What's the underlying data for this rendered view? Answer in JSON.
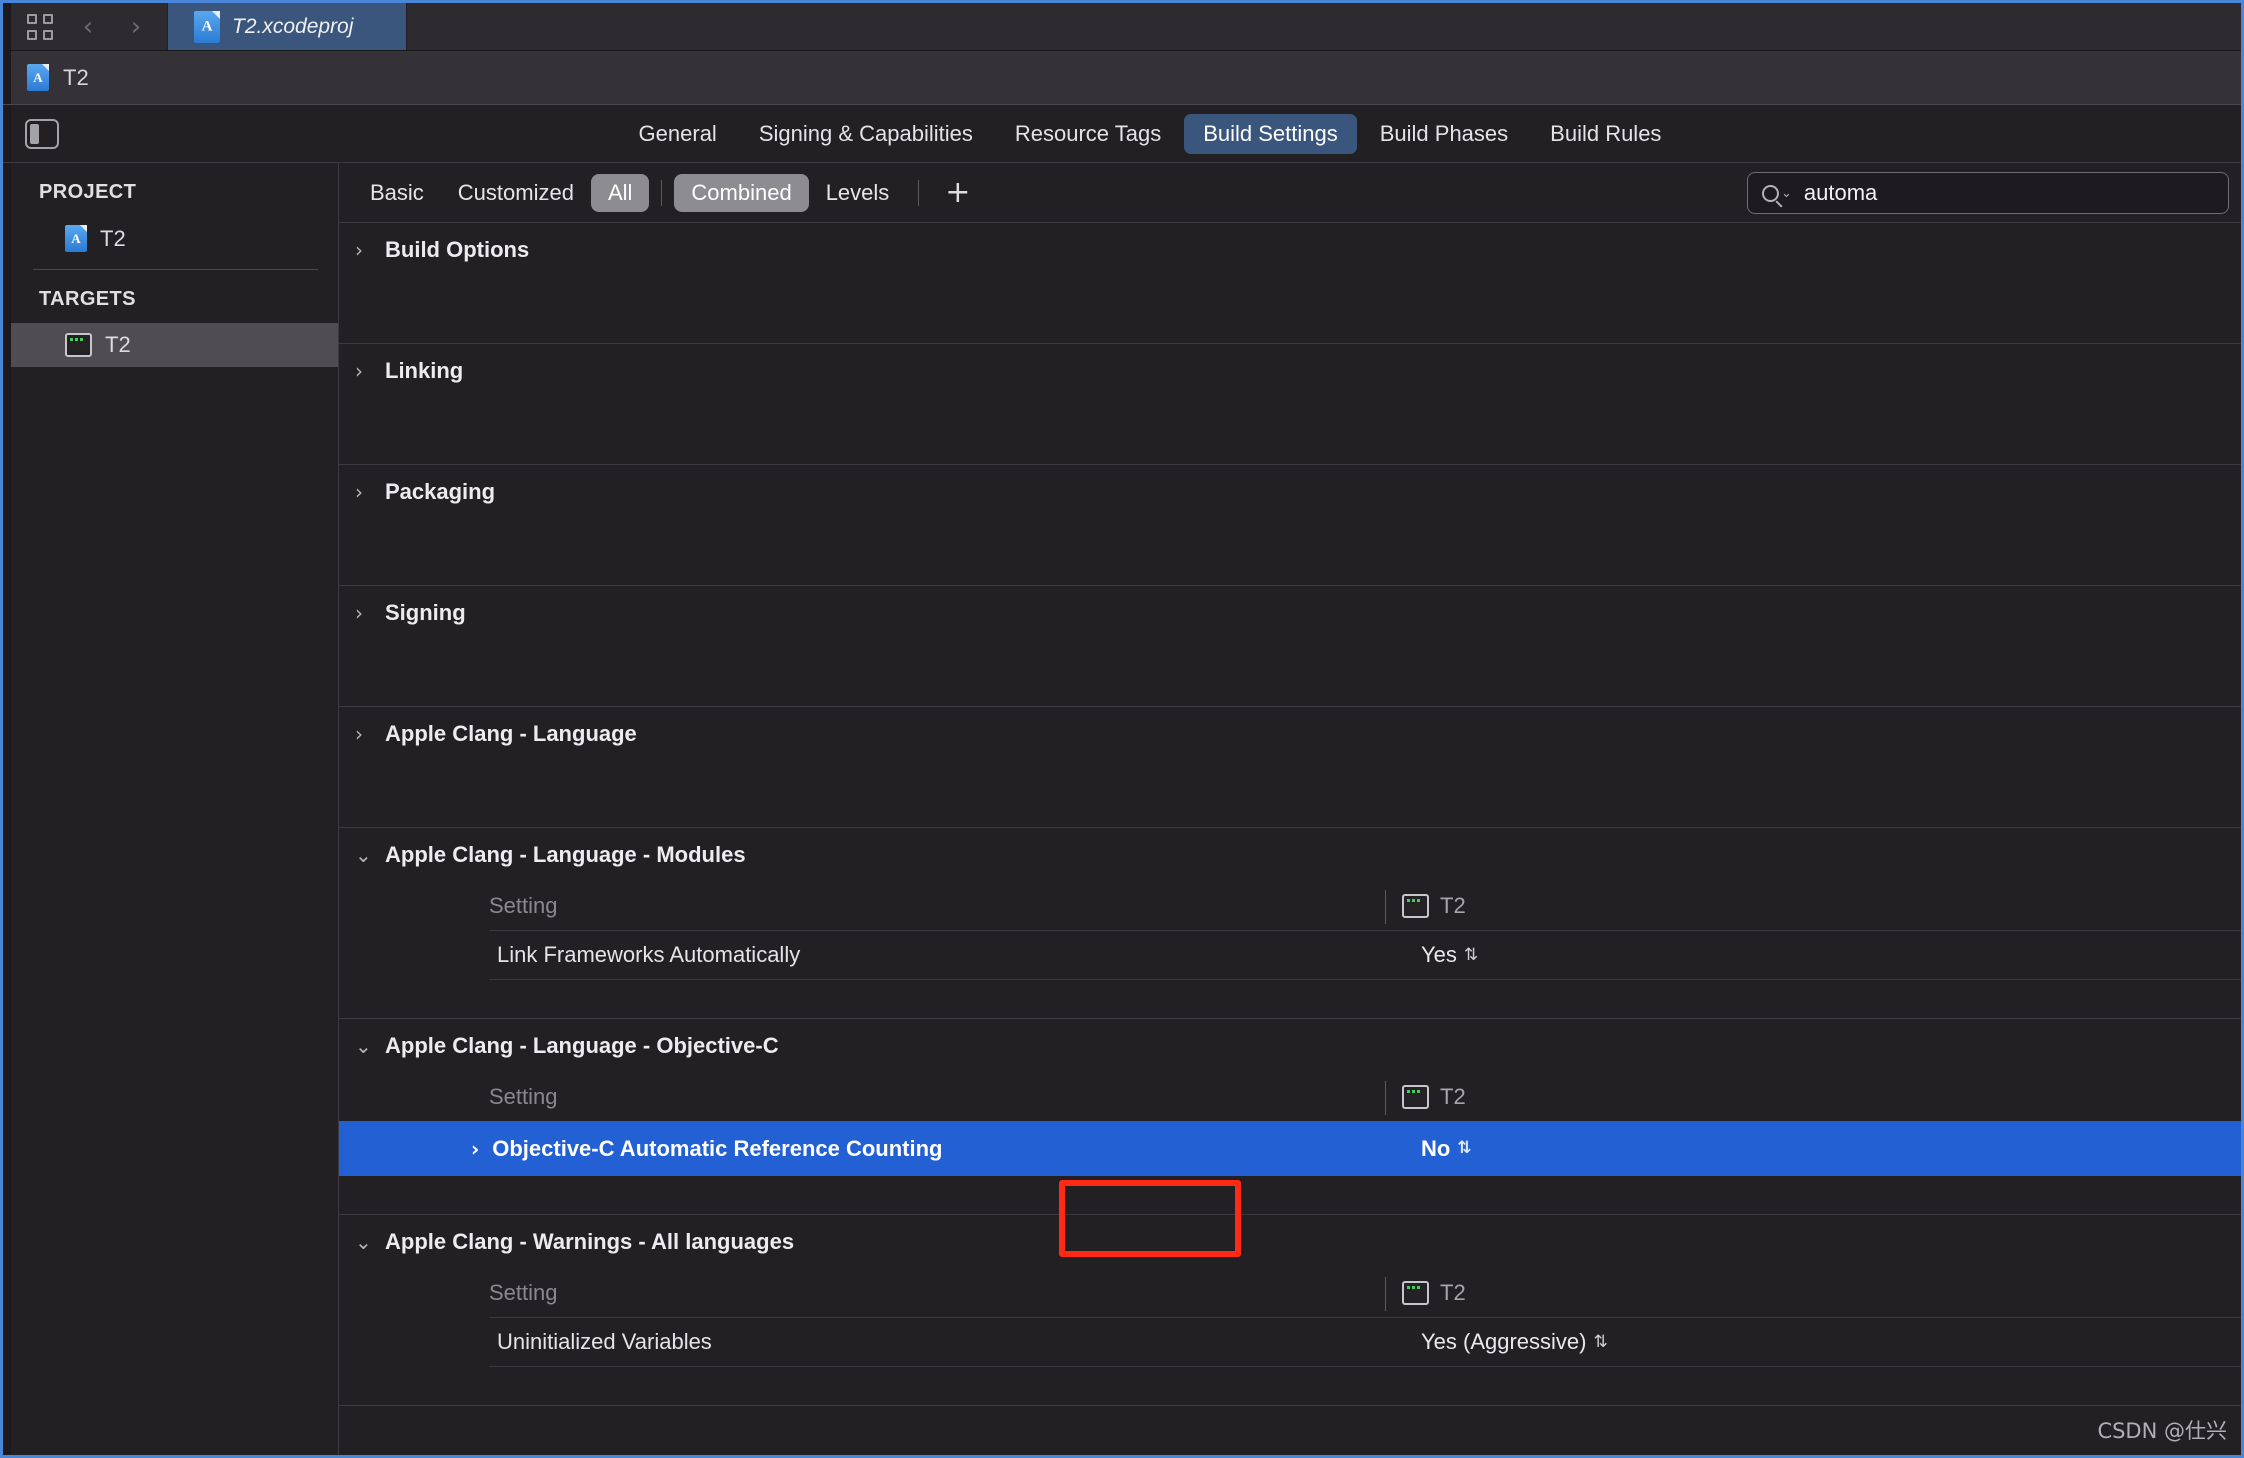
{
  "window": {
    "accent_blue": "#4a86d8",
    "background": "#232024",
    "selection_blue": "#2360d4",
    "annotation_red": "#ff2a16"
  },
  "tabbar": {
    "grid_icon": "grid-icon",
    "back_arrow": "‹",
    "forward_arrow": "›",
    "tab_label": "T2.xcodeproj",
    "tab_icon": "xcodeproj-icon"
  },
  "jumpbar": {
    "label": "T2",
    "icon": "xcodeproj-icon"
  },
  "toptabs": {
    "sidebar_toggle_icon": "sidebar-toggle-icon",
    "items": [
      {
        "label": "General",
        "active": false
      },
      {
        "label": "Signing & Capabilities",
        "active": false
      },
      {
        "label": "Resource Tags",
        "active": false
      },
      {
        "label": "Build Settings",
        "active": true
      },
      {
        "label": "Build Phases",
        "active": false
      },
      {
        "label": "Build Rules",
        "active": false
      }
    ]
  },
  "filterbar": {
    "items": [
      {
        "label": "Basic",
        "on": false
      },
      {
        "label": "Customized",
        "on": false
      },
      {
        "label": "All",
        "on": true
      }
    ],
    "items2": [
      {
        "label": "Combined",
        "on": true
      },
      {
        "label": "Levels",
        "on": false
      }
    ],
    "add_label": "+",
    "search": {
      "icon": "search-icon",
      "chevron": "⌄",
      "value": "automa",
      "placeholder": "Search"
    }
  },
  "sidebar": {
    "project_header": "PROJECT",
    "project_items": [
      {
        "label": "T2",
        "icon": "xcodeproj-icon",
        "selected": false
      }
    ],
    "targets_header": "TARGETS",
    "target_items": [
      {
        "label": "T2",
        "icon": "target-terminal-icon",
        "selected": true
      }
    ]
  },
  "settings": {
    "column_setting_label": "Setting",
    "column_target_label": "T2",
    "column_target_icon": "target-terminal-icon",
    "sections": [
      {
        "title": "Build Options",
        "expanded": false,
        "rows": []
      },
      {
        "title": "Linking",
        "expanded": false,
        "rows": []
      },
      {
        "title": "Packaging",
        "expanded": false,
        "rows": []
      },
      {
        "title": "Signing",
        "expanded": false,
        "rows": []
      },
      {
        "title": "Apple Clang - Language",
        "expanded": false,
        "rows": []
      },
      {
        "title": "Apple Clang - Language - Modules",
        "expanded": true,
        "rows": [
          {
            "name": "Link Frameworks Automatically",
            "value": "Yes",
            "selected": false
          }
        ]
      },
      {
        "title": "Apple Clang - Language - Objective-C",
        "expanded": true,
        "rows": [
          {
            "name": "Objective-C Automatic Reference Counting",
            "value": "No",
            "selected": true,
            "chevron": "›"
          }
        ]
      },
      {
        "title": "Apple Clang - Warnings - All languages",
        "expanded": true,
        "rows": [
          {
            "name": "Uninitialized Variables",
            "value": "Yes (Aggressive)",
            "selected": false
          }
        ]
      }
    ],
    "stepper_glyph": "⌃⌄"
  },
  "watermark": {
    "text": "CSDN @仕兴"
  },
  "glyphs": {
    "chevron_right": "›",
    "chevron_down": "⌄",
    "stepper": "⇅"
  }
}
